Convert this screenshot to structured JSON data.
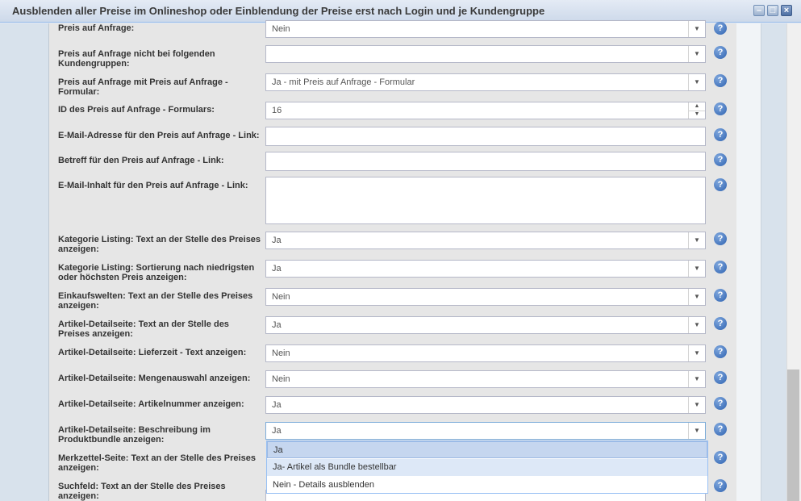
{
  "window": {
    "title": "Ausblenden aller Preise im Onlineshop oder Einblendung der Preise erst nach Login und je Kundengruppe",
    "minimize_icon": "minimize-icon",
    "maximize_icon": "maximize-icon",
    "close_icon": "close-icon"
  },
  "form": {
    "rows": [
      {
        "label": "Preis auf Anfrage:",
        "value": "Nein",
        "type": "select"
      },
      {
        "label": "Preis auf Anfrage nicht bei folgenden Kundengruppen:",
        "value": "",
        "type": "select"
      },
      {
        "label": "Preis auf Anfrage mit Preis auf Anfrage - Formular:",
        "value": "Ja - mit Preis auf Anfrage - Formular",
        "type": "select"
      },
      {
        "label": "ID des Preis auf Anfrage - Formulars:",
        "value": "16",
        "type": "number"
      },
      {
        "label": "E-Mail-Adresse für den Preis auf Anfrage - Link:",
        "value": "",
        "type": "text"
      },
      {
        "label": "Betreff für den Preis auf Anfrage - Link:",
        "value": "",
        "type": "text"
      },
      {
        "label": "E-Mail-Inhalt für den Preis auf Anfrage - Link:",
        "value": "",
        "type": "textarea"
      },
      {
        "label": "Kategorie Listing: Text an der Stelle des Preises anzeigen:",
        "value": "Ja",
        "type": "select"
      },
      {
        "label": "Kategorie Listing: Sortierung nach niedrigsten oder höchsten Preis anzeigen:",
        "value": "Ja",
        "type": "select"
      },
      {
        "label": "Einkaufswelten: Text an der Stelle des Preises anzeigen:",
        "value": "Nein",
        "type": "select"
      },
      {
        "label": "Artikel-Detailseite: Text an der Stelle des Preises anzeigen:",
        "value": "Ja",
        "type": "select"
      },
      {
        "label": "Artikel-Detailseite: Lieferzeit - Text anzeigen:",
        "value": "Nein",
        "type": "select"
      },
      {
        "label": "Artikel-Detailseite: Mengenauswahl anzeigen:",
        "value": "Nein",
        "type": "select"
      },
      {
        "label": "Artikel-Detailseite: Artikelnummer anzeigen:",
        "value": "Ja",
        "type": "select"
      },
      {
        "label": "Artikel-Detailseite: Beschreibung im Produktbundle anzeigen:",
        "value": "Ja",
        "type": "select"
      },
      {
        "label": "Merkzettel-Seite: Text an der Stelle des Preises anzeigen:",
        "value": "",
        "type": "select"
      },
      {
        "label": "Suchfeld: Text an der Stelle des Preises anzeigen:",
        "value": "",
        "type": "select"
      }
    ],
    "help_label": "?"
  },
  "dropdown": {
    "options": [
      "Ja",
      "Ja- Artikel als Bundle bestellbar",
      "Nein - Details ausblenden"
    ],
    "selected_index": 0
  }
}
